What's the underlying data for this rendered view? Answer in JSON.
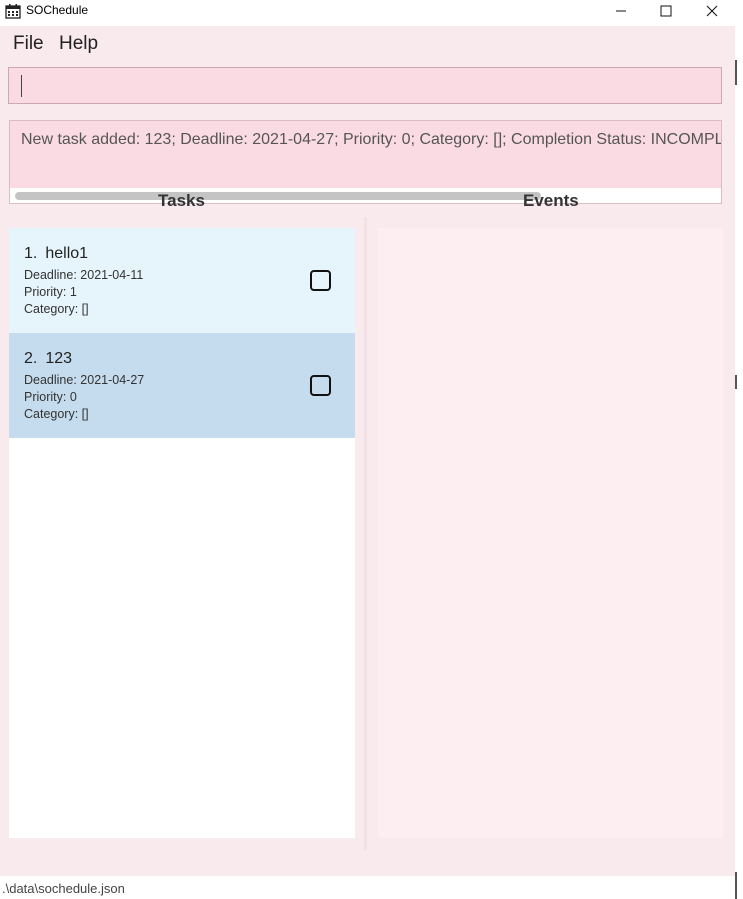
{
  "window": {
    "title": "SOChedule",
    "icons": {
      "app": "calendar-icon",
      "minimize": "minimize-icon",
      "maximize": "maximize-icon",
      "close": "close-icon"
    }
  },
  "menu": {
    "file": "File",
    "help": "Help"
  },
  "command_box": {
    "value": "",
    "placeholder": ""
  },
  "result": {
    "text": "New task added: 123; Deadline: 2021-04-27; Priority: 0; Category: []; Completion Status: INCOMPLETE"
  },
  "panes": {
    "tasks_title": "Tasks",
    "events_title": "Events"
  },
  "tasks": [
    {
      "index": "1.",
      "name": "hello1",
      "deadline": "Deadline: 2021-04-11",
      "priority": "Priority: 1",
      "category": "Category: []",
      "completed": false
    },
    {
      "index": "2.",
      "name": "123",
      "deadline": "Deadline: 2021-04-27",
      "priority": "Priority: 0",
      "category": "Category: []",
      "completed": false
    }
  ],
  "events": [],
  "status_bar": {
    "path": ".\\data\\sochedule.json"
  },
  "colors": {
    "app_bg": "#f9eaee",
    "command_bg": "#fadbe4",
    "task_card_1": "#e6f4fc",
    "task_card_2_selected": "#c5dcee",
    "events_bg": "#fdeef1"
  }
}
